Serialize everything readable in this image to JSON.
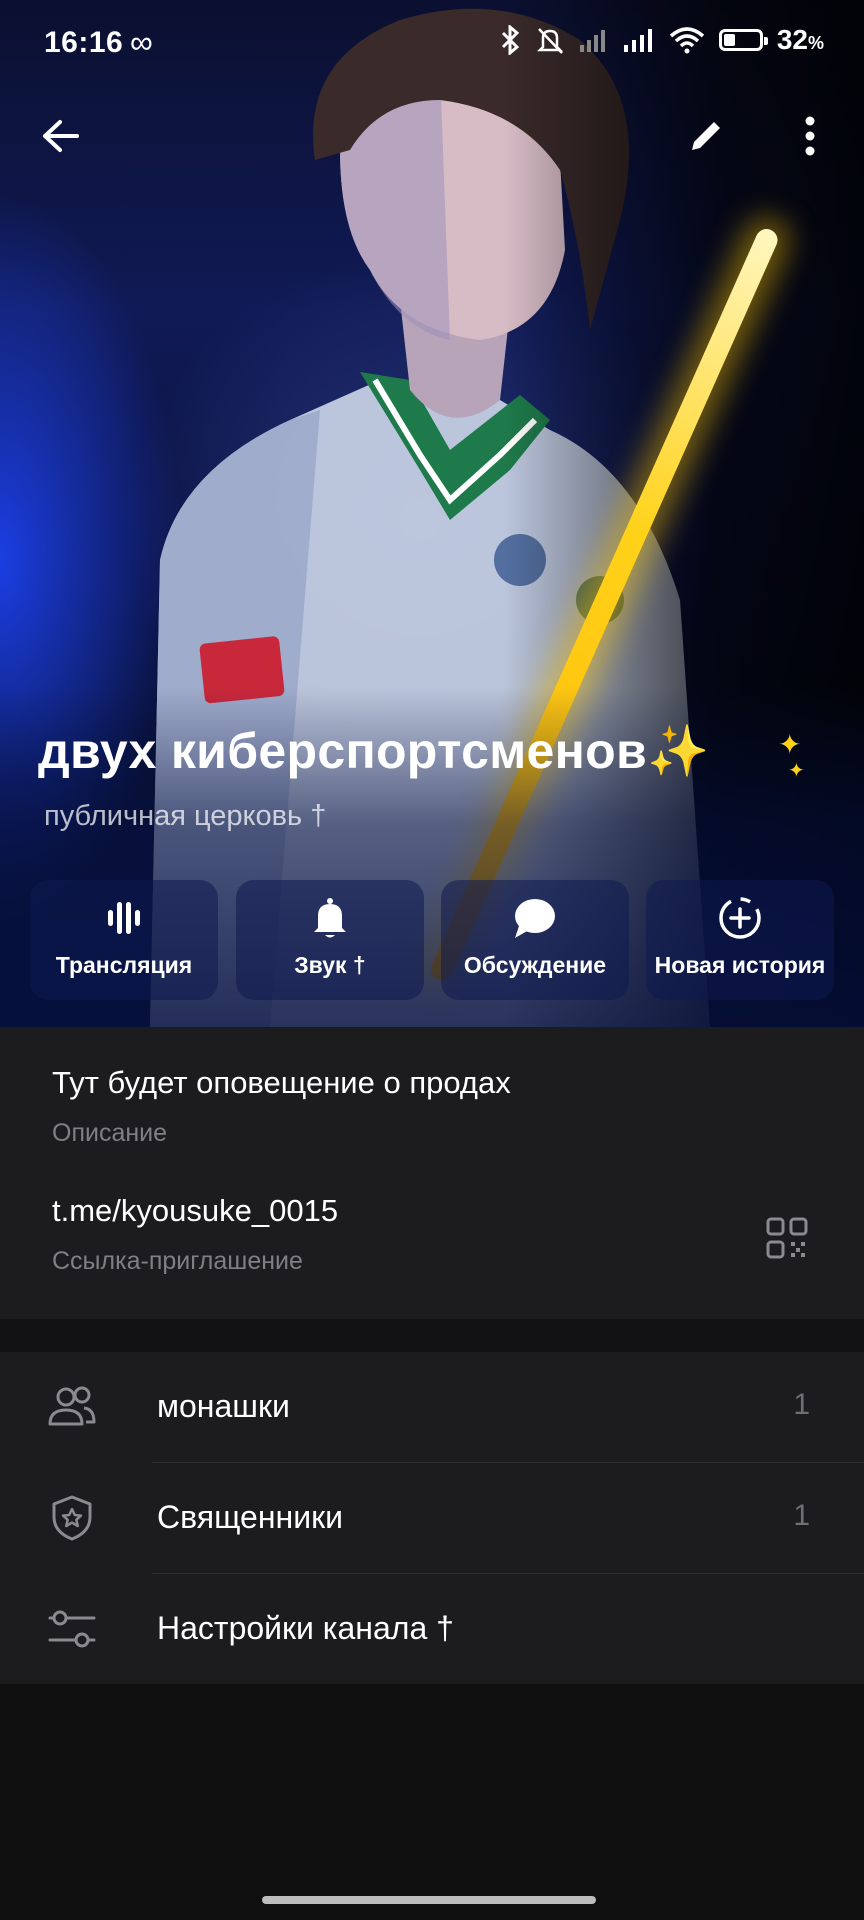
{
  "status_bar": {
    "time": "16:16",
    "battery_percent": "32",
    "battery_unit": "%",
    "battery_level": 0.32
  },
  "channel": {
    "title": "двух киберспортсменов✨",
    "sparkle": "✦",
    "subtitle": "публичная церковь †"
  },
  "actions": [
    {
      "label": "Трансляция",
      "icon": "live-stream-icon"
    },
    {
      "label": "Звук †",
      "icon": "bell-icon"
    },
    {
      "label": "Обсуждение",
      "icon": "chat-bubble-icon"
    },
    {
      "label": "Новая история",
      "icon": "add-story-icon"
    }
  ],
  "info": {
    "description_text": "Тут будет оповещение о продах",
    "description_label": "Описание",
    "link_text": "t.me/kyousuke_0015",
    "link_label": "Ссылка-приглашение"
  },
  "list": [
    {
      "label": "монашки",
      "count": "1",
      "icon": "members-icon"
    },
    {
      "label": "Священники",
      "count": "1",
      "icon": "admin-shield-icon"
    },
    {
      "label": "Настройки канала †",
      "count": "",
      "icon": "settings-sliders-icon"
    }
  ],
  "colors": {
    "accent_beam": "#ffd21a",
    "background": "#1c1c1e",
    "muted_text": "#7f7f84"
  }
}
